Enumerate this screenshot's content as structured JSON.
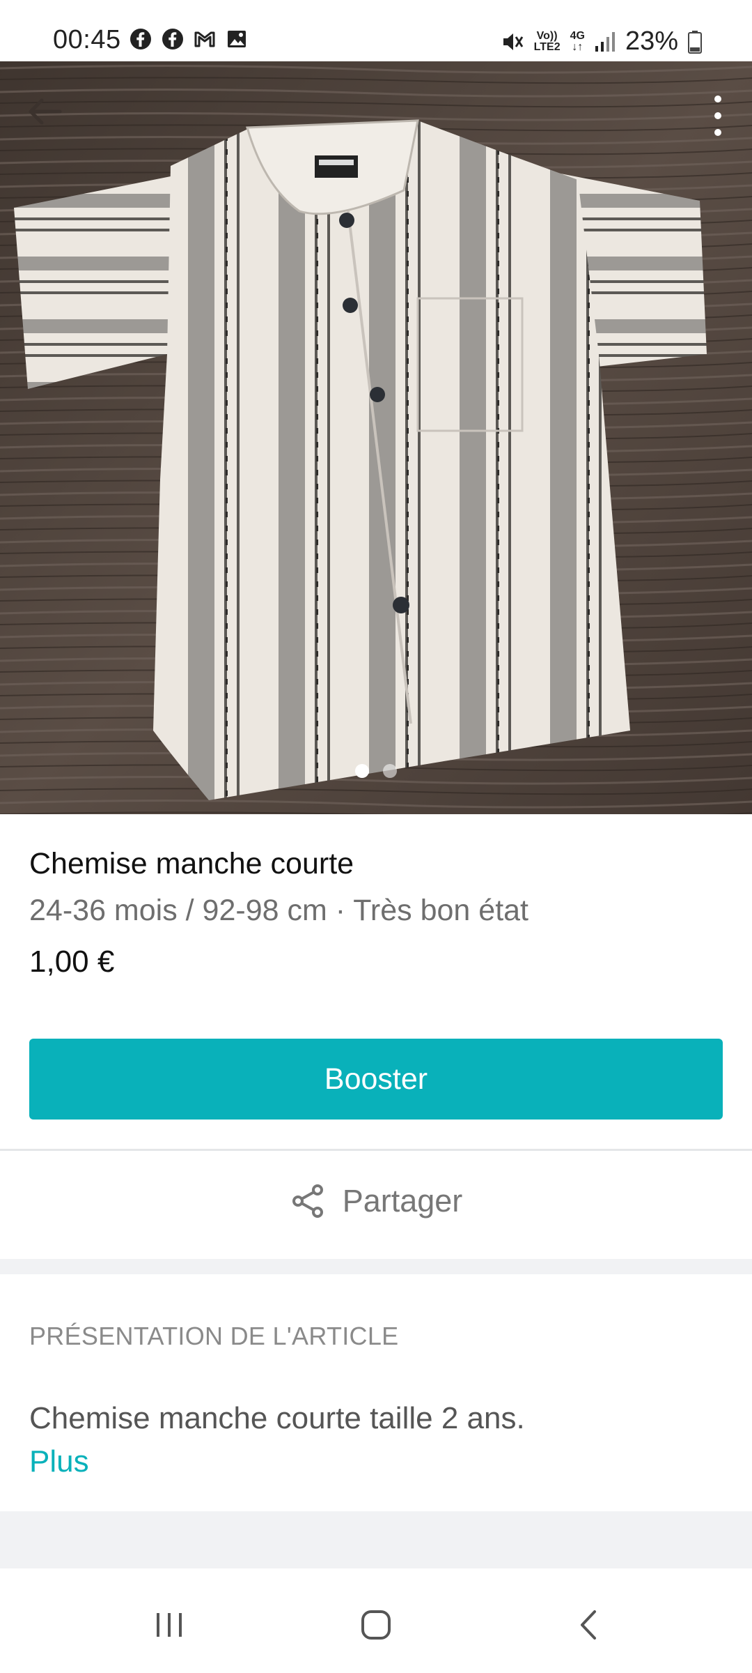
{
  "status_bar": {
    "time": "00:45",
    "left_icons": [
      "facebook-icon",
      "facebook-icon",
      "gmail-icon",
      "gallery-icon"
    ],
    "network_top": "Vo))",
    "network_bottom": "LTE2",
    "network_type": "4G",
    "battery": "23%"
  },
  "photo": {
    "page_count": 2,
    "active_page": 1,
    "alt": "Chemise manche courte"
  },
  "item": {
    "title": "Chemise manche courte",
    "details": "24-36 mois / 92-98 cm · Très bon état",
    "price": "1,00 €"
  },
  "actions": {
    "booster_label": "Booster",
    "share_label": "Partager"
  },
  "description": {
    "section_title": "PRÉSENTATION DE L'ARTICLE",
    "text": "Chemise manche courte taille 2 ans.",
    "more_label": "Plus"
  },
  "colors": {
    "accent": "#09b1ba",
    "separator": "#f1f2f4"
  }
}
